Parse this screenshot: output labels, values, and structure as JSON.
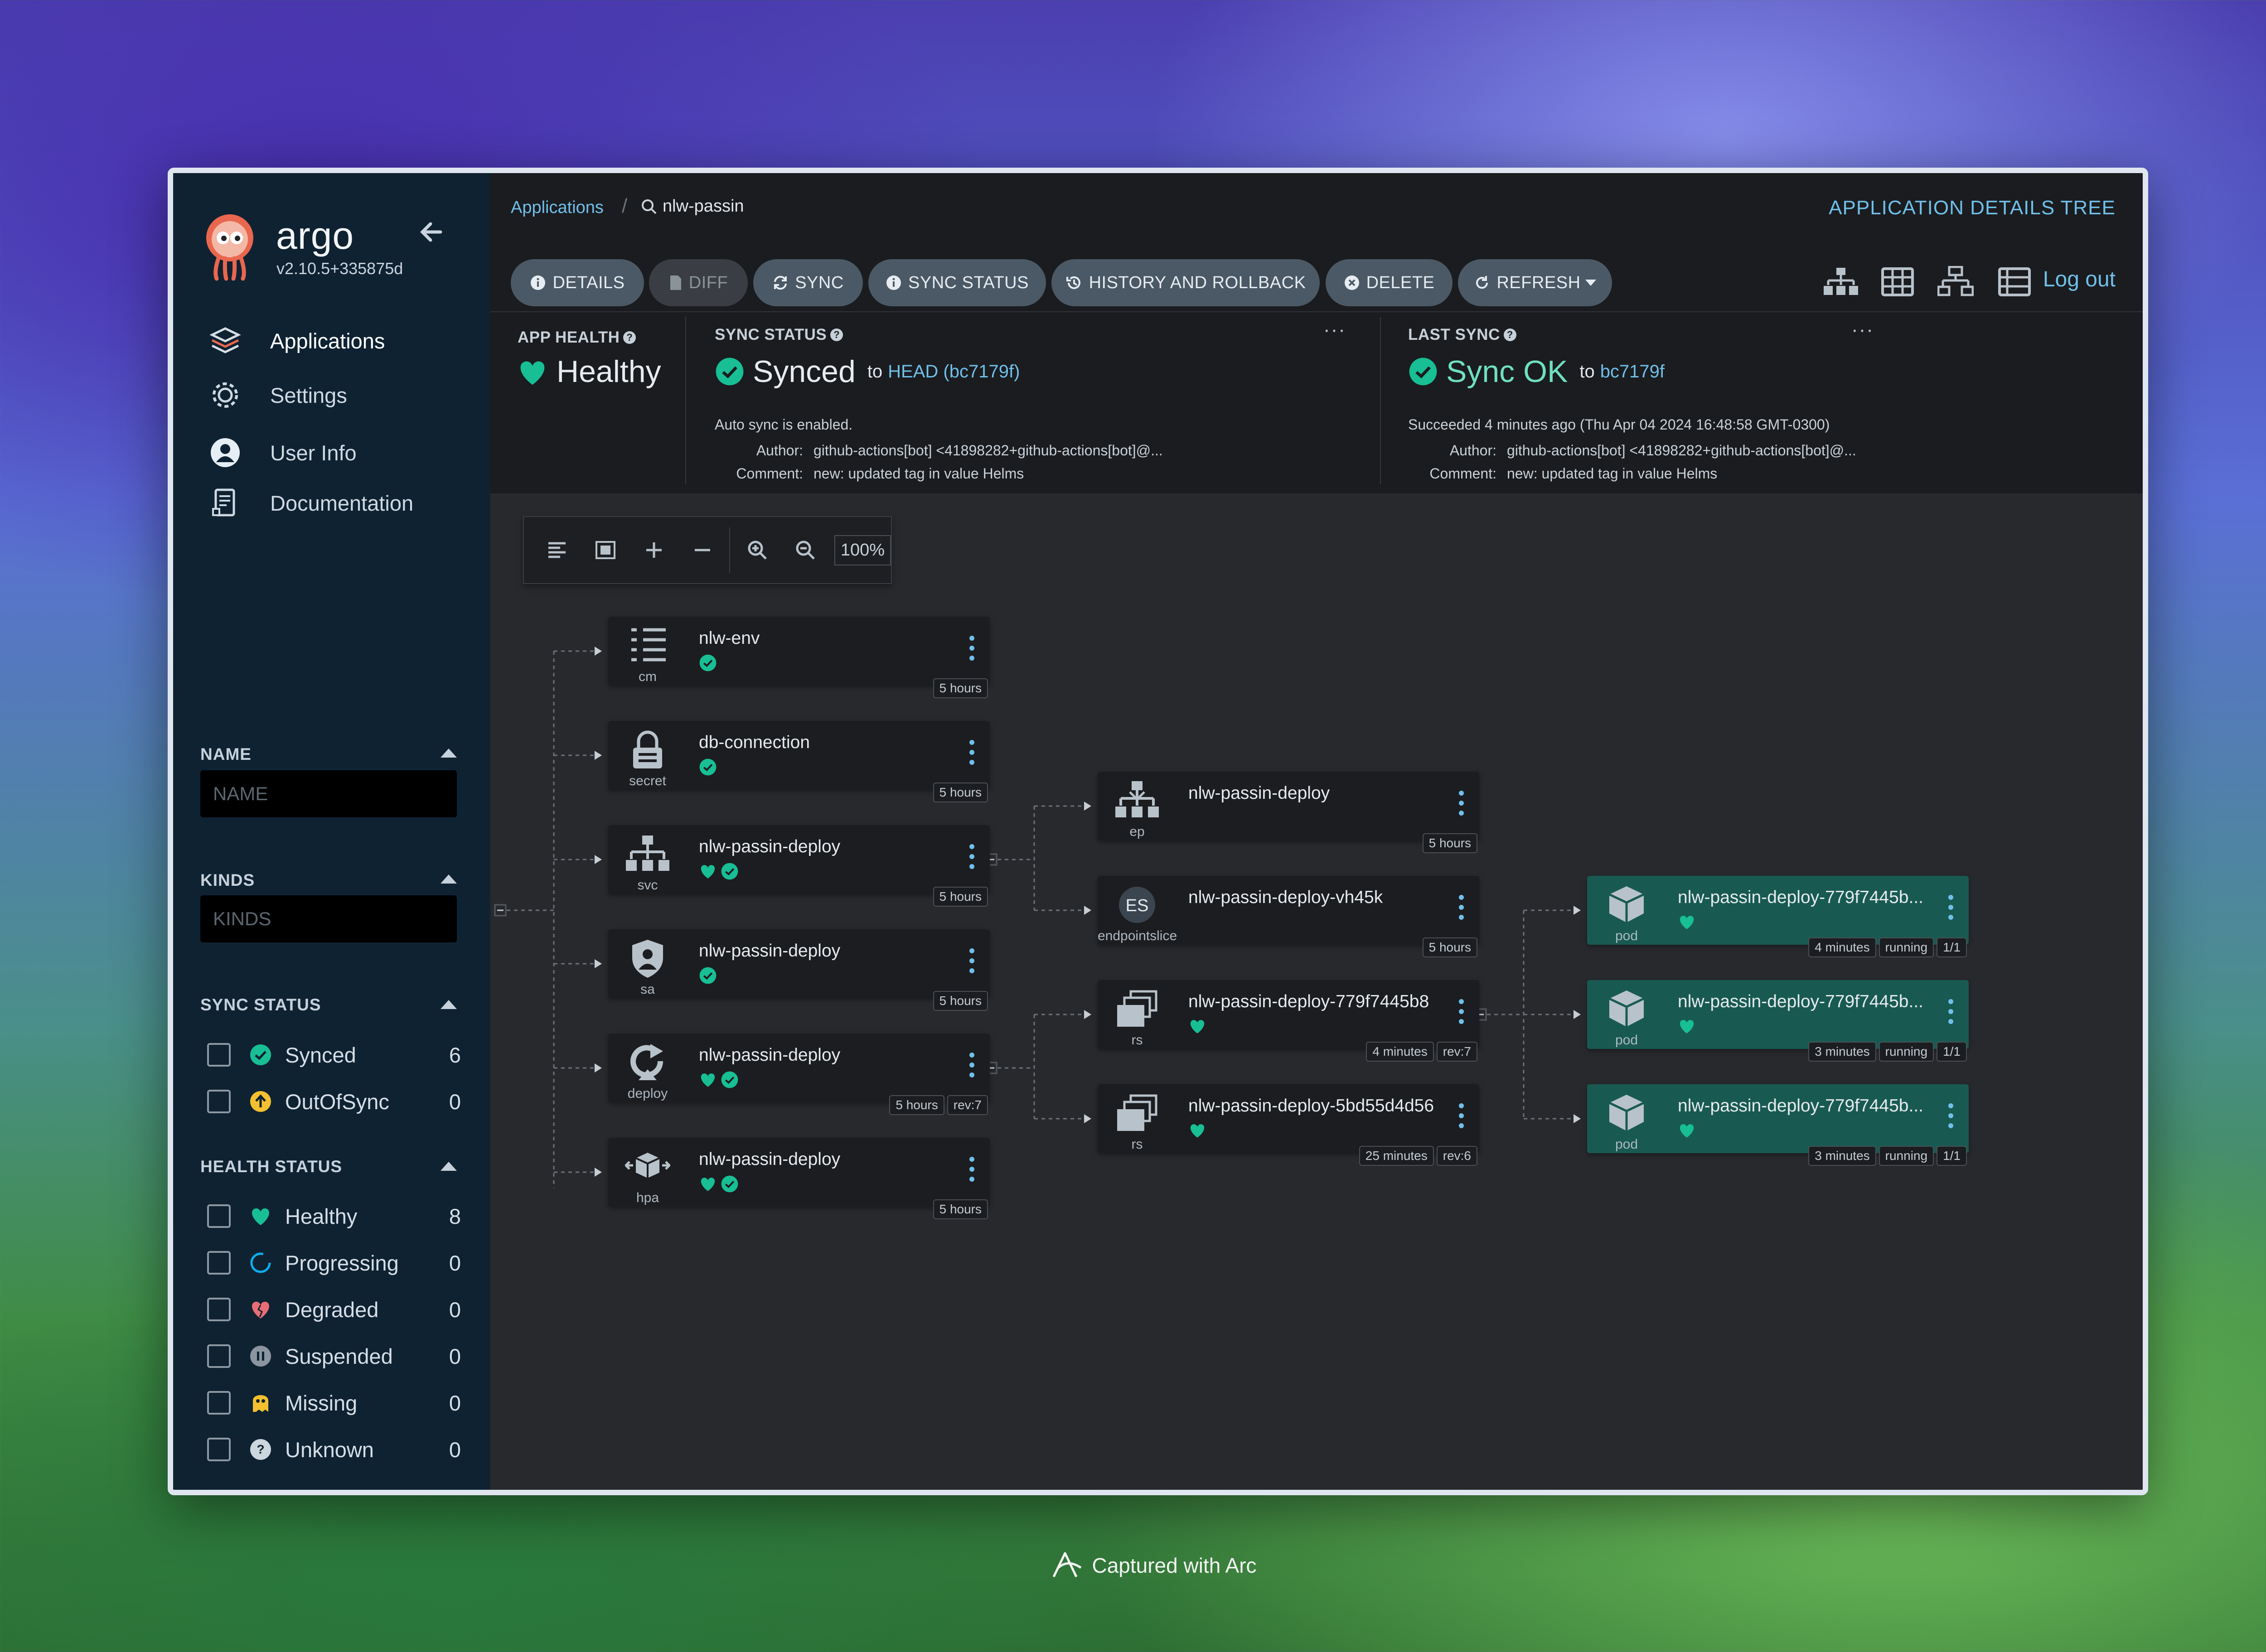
{
  "app": {
    "brand": "argo",
    "version": "v2.10.5+335875d"
  },
  "nav": [
    {
      "label": "Applications",
      "icon": "layers-icon",
      "active": true
    },
    {
      "label": "Settings",
      "icon": "gear-icon"
    },
    {
      "label": "User Info",
      "icon": "user-icon"
    },
    {
      "label": "Documentation",
      "icon": "docs-icon"
    }
  ],
  "filters": {
    "name": {
      "title": "NAME",
      "placeholder": "NAME"
    },
    "kinds": {
      "title": "KINDS",
      "placeholder": "KINDS"
    },
    "sync": {
      "title": "SYNC STATUS",
      "items": [
        {
          "label": "Synced",
          "count": "6",
          "color": "#18be94"
        },
        {
          "label": "OutOfSync",
          "count": "0",
          "color": "#f4c030"
        }
      ]
    },
    "health": {
      "title": "HEALTH STATUS",
      "items": [
        {
          "label": "Healthy",
          "count": "8",
          "color": "#18be94"
        },
        {
          "label": "Progressing",
          "count": "0",
          "color": "#0dadea"
        },
        {
          "label": "Degraded",
          "count": "0",
          "color": "#e96d76"
        },
        {
          "label": "Suspended",
          "count": "0",
          "color": "#8b95a0"
        },
        {
          "label": "Missing",
          "count": "0",
          "color": "#f4c030"
        },
        {
          "label": "Unknown",
          "count": "0",
          "color": "#ccd6dd"
        }
      ]
    }
  },
  "breadcrumb": {
    "link": "Applications",
    "search": "nlw-passin"
  },
  "page_title": "APPLICATION DETAILS TREE",
  "toolbar": {
    "buttons": [
      {
        "label": "DETAILS",
        "icon": "info-icon"
      },
      {
        "label": "DIFF",
        "icon": "file-icon",
        "disabled": true
      },
      {
        "label": "SYNC",
        "icon": "sync-icon"
      },
      {
        "label": "SYNC STATUS",
        "icon": "info-icon"
      },
      {
        "label": "HISTORY AND ROLLBACK",
        "icon": "history-icon"
      },
      {
        "label": "DELETE",
        "icon": "times-circle-icon"
      },
      {
        "label": "REFRESH",
        "icon": "redo-icon"
      }
    ],
    "logout": "Log out"
  },
  "status": {
    "app_health": {
      "label": "APP HEALTH",
      "value": "Healthy"
    },
    "sync_status": {
      "label": "SYNC STATUS",
      "value": "Synced",
      "to": "to",
      "target": "HEAD (bc7179f)",
      "auto": "Auto sync is enabled.",
      "author_label": "Author:",
      "author": "github-actions[bot] <41898282+github-actions[bot]@...",
      "comment_label": "Comment:",
      "comment": "new: updated tag in value Helms"
    },
    "last_sync": {
      "label": "LAST SYNC",
      "value": "Sync OK",
      "to": "to",
      "target": "bc7179f",
      "succeeded": "Succeeded 4 minutes ago (Thu Apr 04 2024 16:48:58 GMT-0300)",
      "author_label": "Author:",
      "author": "github-actions[bot] <41898282+github-actions[bot]@...",
      "comment_label": "Comment:",
      "comment": "new: updated tag in value Helms"
    }
  },
  "zoom": "100%",
  "nodes": [
    {
      "name": "nlw-env",
      "kind": "cm",
      "icon": "configmap-icon",
      "status": [
        "synced"
      ],
      "tags": [
        "5 hours"
      ],
      "pod": false
    },
    {
      "name": "db-connection",
      "kind": "secret",
      "icon": "secret-icon",
      "status": [
        "synced"
      ],
      "tags": [
        "5 hours"
      ],
      "pod": false
    },
    {
      "name": "nlw-passin-deploy",
      "kind": "svc",
      "icon": "service-icon",
      "status": [
        "healthy",
        "synced"
      ],
      "tags": [
        "5 hours"
      ],
      "pod": false
    },
    {
      "name": "nlw-passin-deploy",
      "kind": "sa",
      "icon": "serviceaccount-icon",
      "status": [
        "synced"
      ],
      "tags": [
        "5 hours"
      ],
      "pod": false
    },
    {
      "name": "nlw-passin-deploy",
      "kind": "deploy",
      "icon": "deployment-icon",
      "status": [
        "healthy",
        "synced"
      ],
      "tags": [
        "5 hours",
        "rev:7"
      ],
      "pod": false
    },
    {
      "name": "nlw-passin-deploy",
      "kind": "hpa",
      "icon": "hpa-icon",
      "status": [
        "healthy",
        "synced"
      ],
      "tags": [
        "5 hours"
      ],
      "pod": false
    },
    {
      "name": "nlw-passin-deploy",
      "kind": "ep",
      "icon": "endpoints-icon",
      "status": [],
      "tags": [
        "5 hours"
      ],
      "pod": false
    },
    {
      "name": "nlw-passin-deploy-vh45k",
      "kind": "endpointslice",
      "icon": "endpointslice-icon",
      "status": [],
      "tags": [
        "5 hours"
      ],
      "pod": false
    },
    {
      "name": "nlw-passin-deploy-779f7445b8",
      "kind": "rs",
      "icon": "replicaset-icon",
      "status": [
        "healthy"
      ],
      "tags": [
        "4 minutes",
        "rev:7"
      ],
      "pod": false
    },
    {
      "name": "nlw-passin-deploy-5bd55d4d56",
      "kind": "rs",
      "icon": "replicaset-icon",
      "status": [
        "healthy"
      ],
      "tags": [
        "25 minutes",
        "rev:6"
      ],
      "pod": false
    },
    {
      "name": "nlw-passin-deploy-779f7445b...",
      "kind": "pod",
      "icon": "pod-icon",
      "status": [
        "healthy"
      ],
      "tags": [
        "4 minutes",
        "running",
        "1/1"
      ],
      "pod": true
    },
    {
      "name": "nlw-passin-deploy-779f7445b...",
      "kind": "pod",
      "icon": "pod-icon",
      "status": [
        "healthy"
      ],
      "tags": [
        "3 minutes",
        "running",
        "1/1"
      ],
      "pod": true
    },
    {
      "name": "nlw-passin-deploy-779f7445b...",
      "kind": "pod",
      "icon": "pod-icon",
      "status": [
        "healthy"
      ],
      "tags": [
        "3 minutes",
        "running",
        "1/1"
      ],
      "pod": true
    }
  ],
  "footer": "Captured with Arc"
}
